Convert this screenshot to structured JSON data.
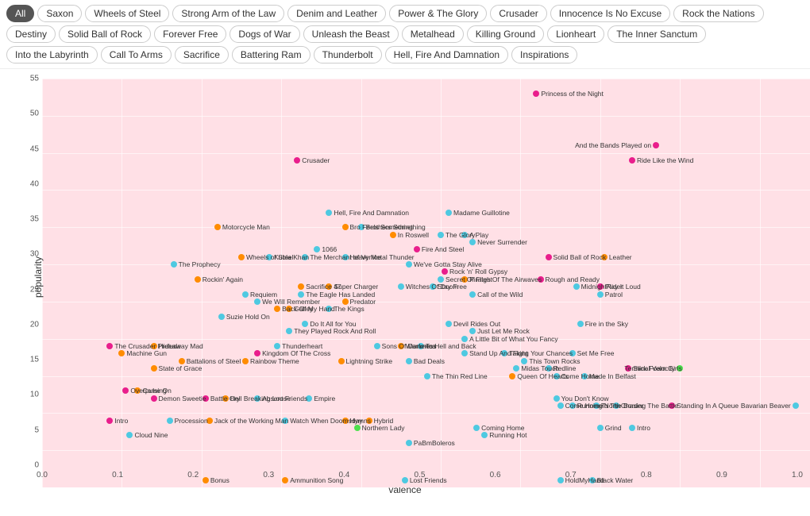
{
  "filters": {
    "rows": [
      [
        {
          "label": "All",
          "active": true
        },
        {
          "label": "Saxon",
          "active": false
        },
        {
          "label": "Wheels of Steel",
          "active": false
        },
        {
          "label": "Strong Arm of the Law",
          "active": false
        },
        {
          "label": "Denim and Leather",
          "active": false
        },
        {
          "label": "Power & The Glory",
          "active": false
        },
        {
          "label": "Crusader",
          "active": false
        },
        {
          "label": "Innocence Is No Excuse",
          "active": false
        },
        {
          "label": "Rock the Nations",
          "active": false
        }
      ],
      [
        {
          "label": "Destiny",
          "active": false
        },
        {
          "label": "Solid Ball of Rock",
          "active": false
        },
        {
          "label": "Forever Free",
          "active": false
        },
        {
          "label": "Dogs of War",
          "active": false
        },
        {
          "label": "Unleash the Beast",
          "active": false
        },
        {
          "label": "Metalhead",
          "active": false
        },
        {
          "label": "Killing Ground",
          "active": false
        },
        {
          "label": "Lionheart",
          "active": false
        },
        {
          "label": "The Inner Sanctum",
          "active": false
        }
      ],
      [
        {
          "label": "Into the Labyrinth",
          "active": false
        },
        {
          "label": "Call To Arms",
          "active": false
        },
        {
          "label": "Sacrifice",
          "active": false
        },
        {
          "label": "Battering Ram",
          "active": false
        },
        {
          "label": "Thunderbolt",
          "active": false
        },
        {
          "label": "Hell, Fire And Damnation",
          "active": false
        },
        {
          "label": "Inspirations",
          "active": false
        }
      ]
    ]
  },
  "chart": {
    "xlabel": "valence",
    "ylabel": "popularity",
    "xmin": 0,
    "xmax": 1,
    "ymin": 0,
    "ymax": 55,
    "xticks": [
      0,
      0.1,
      0.2,
      0.3,
      0.4,
      0.5,
      0.6,
      0.7,
      0.8,
      0.9,
      1.0
    ],
    "yticks": [
      0,
      5,
      10,
      15,
      20,
      25,
      30,
      35,
      40,
      45,
      50,
      55
    ],
    "points": [
      {
        "label": "Princess of the Night",
        "x": 0.62,
        "y": 53,
        "color": "#e91e8c",
        "labelside": "right"
      },
      {
        "label": "And the Bands Played on",
        "x": 0.77,
        "y": 46,
        "color": "#e91e8c",
        "labelside": "left"
      },
      {
        "label": "Ride Like the Wind",
        "x": 0.74,
        "y": 44,
        "color": "#e91e8c",
        "labelside": "right"
      },
      {
        "label": "Crusader",
        "x": 0.32,
        "y": 44,
        "color": "#e91e8c",
        "labelside": "right"
      },
      {
        "label": "Madame Guillotine",
        "x": 0.51,
        "y": 37,
        "color": "#4ec9e1",
        "labelside": "right"
      },
      {
        "label": "Hell, Fire And Damnation",
        "x": 0.36,
        "y": 37,
        "color": "#4ec9e1",
        "labelside": "right"
      },
      {
        "label": "Brothers Something",
        "x": 0.4,
        "y": 35,
        "color": "#4ec9e1",
        "labelside": "right"
      },
      {
        "label": "Bro Feels Something",
        "x": 0.38,
        "y": 35,
        "color": "#ff8c00",
        "labelside": "right"
      },
      {
        "label": "In Roswell",
        "x": 0.44,
        "y": 34,
        "color": "#ff8c00",
        "labelside": "right"
      },
      {
        "label": "The Glory",
        "x": 0.5,
        "y": 34,
        "color": "#4ec9e1",
        "labelside": "right"
      },
      {
        "label": "A Play",
        "x": 0.53,
        "y": 34,
        "color": "#4ec9e1",
        "labelside": "right"
      },
      {
        "label": "Never Surrender",
        "x": 0.54,
        "y": 33,
        "color": "#4ec9e1",
        "labelside": "right"
      },
      {
        "label": "Motorcycle Man",
        "x": 0.22,
        "y": 35,
        "color": "#ff8c00",
        "labelside": "right"
      },
      {
        "label": "Wheels of Steel",
        "x": 0.25,
        "y": 31,
        "color": "#ff8c00",
        "labelside": "right"
      },
      {
        "label": "The Prophecy",
        "x": 0.165,
        "y": 30,
        "color": "#4ec9e1",
        "labelside": "right"
      },
      {
        "label": "Fire And Steel",
        "x": 0.47,
        "y": 32,
        "color": "#e91e8c",
        "labelside": "right"
      },
      {
        "label": "Heavy Metal Thunder",
        "x": 0.38,
        "y": 31,
        "color": "#4ec9e1",
        "labelside": "right"
      },
      {
        "label": "1066",
        "x": 0.345,
        "y": 32,
        "color": "#4ec9e1",
        "labelside": "right"
      },
      {
        "label": "Kubla Khan",
        "x": 0.285,
        "y": 31,
        "color": "#4ec9e1",
        "labelside": "right"
      },
      {
        "label": "The Merchant of Venice",
        "x": 0.33,
        "y": 31,
        "color": "#4ec9e1",
        "labelside": "right"
      },
      {
        "label": "Solid Ball of Rock",
        "x": 0.635,
        "y": 31,
        "color": "#e91e8c",
        "labelside": "right"
      },
      {
        "label": "Leather",
        "x": 0.705,
        "y": 31,
        "color": "#ff8c00",
        "labelside": "right"
      },
      {
        "label": "Rock 'n' Roll Gypsy",
        "x": 0.505,
        "y": 29,
        "color": "#e91e8c",
        "labelside": "right"
      },
      {
        "label": "Pirates Of The Airwaves",
        "x": 0.53,
        "y": 28,
        "color": "#ff8c00",
        "labelside": "right"
      },
      {
        "label": "Rough and Ready",
        "x": 0.625,
        "y": 28,
        "color": "#e91e8c",
        "labelside": "right"
      },
      {
        "label": "Rockin' Again",
        "x": 0.195,
        "y": 28,
        "color": "#ff8c00",
        "labelside": "right"
      },
      {
        "label": "We've Gotta Stay Alive",
        "x": 0.46,
        "y": 30,
        "color": "#4ec9e1",
        "labelside": "right"
      },
      {
        "label": "Secret Of Flight",
        "x": 0.5,
        "y": 28,
        "color": "#4ec9e1",
        "labelside": "right"
      },
      {
        "label": "Witches Of Doom",
        "x": 0.45,
        "y": 27,
        "color": "#4ec9e1",
        "labelside": "right"
      },
      {
        "label": "Stay Free",
        "x": 0.49,
        "y": 27,
        "color": "#4ec9e1",
        "labelside": "right"
      },
      {
        "label": "Play It Loud",
        "x": 0.7,
        "y": 27,
        "color": "#e91e8c",
        "labelside": "right"
      },
      {
        "label": "MidnightRider",
        "x": 0.67,
        "y": 27,
        "color": "#4ec9e1",
        "labelside": "right"
      },
      {
        "label": "Patrol",
        "x": 0.7,
        "y": 26,
        "color": "#4ec9e1",
        "labelside": "right"
      },
      {
        "label": "Sacrifice 47",
        "x": 0.325,
        "y": 27,
        "color": "#ff8c00",
        "labelside": "right"
      },
      {
        "label": "Super Charger",
        "x": 0.36,
        "y": 27,
        "color": "#ff8c00",
        "labelside": "right"
      },
      {
        "label": "The Eagle Has Landed",
        "x": 0.325,
        "y": 26,
        "color": "#4ec9e1",
        "labelside": "right"
      },
      {
        "label": "Predator",
        "x": 0.38,
        "y": 25,
        "color": "#ff8c00",
        "labelside": "right"
      },
      {
        "label": "Requiem",
        "x": 0.255,
        "y": 26,
        "color": "#4ec9e1",
        "labelside": "right"
      },
      {
        "label": "We Will Remember",
        "x": 0.27,
        "y": 25,
        "color": "#4ec9e1",
        "labelside": "right"
      },
      {
        "label": "Back Of My Hand",
        "x": 0.295,
        "y": 24,
        "color": "#ff8c00",
        "labelside": "right"
      },
      {
        "label": "Galley",
        "x": 0.31,
        "y": 24,
        "color": "#ff8c00",
        "labelside": "right"
      },
      {
        "label": "The Kings",
        "x": 0.36,
        "y": 24,
        "color": "#4ec9e1",
        "labelside": "right"
      },
      {
        "label": "Call of the Wild",
        "x": 0.54,
        "y": 26,
        "color": "#4ec9e1",
        "labelside": "right"
      },
      {
        "label": "Suzie Hold On",
        "x": 0.225,
        "y": 23,
        "color": "#4ec9e1",
        "labelside": "right"
      },
      {
        "label": "Do It All for You",
        "x": 0.33,
        "y": 22,
        "color": "#4ec9e1",
        "labelside": "right"
      },
      {
        "label": "They Played Rock And Roll",
        "x": 0.31,
        "y": 21,
        "color": "#4ec9e1",
        "labelside": "right"
      },
      {
        "label": "Devil Rides Out",
        "x": 0.51,
        "y": 22,
        "color": "#4ec9e1",
        "labelside": "right"
      },
      {
        "label": "Just Let Me Rock",
        "x": 0.54,
        "y": 21,
        "color": "#4ec9e1",
        "labelside": "right"
      },
      {
        "label": "Fire in the Sky",
        "x": 0.675,
        "y": 22,
        "color": "#4ec9e1",
        "labelside": "right"
      },
      {
        "label": "The Crusader Prelude",
        "x": 0.085,
        "y": 19,
        "color": "#e91e8c",
        "labelside": "right"
      },
      {
        "label": "Hideaway Mad",
        "x": 0.14,
        "y": 19,
        "color": "#ff8c00",
        "labelside": "right"
      },
      {
        "label": "A Little Bit of What You Fancy",
        "x": 0.53,
        "y": 20,
        "color": "#4ec9e1",
        "labelside": "right"
      },
      {
        "label": "To Hell and Back",
        "x": 0.475,
        "y": 19,
        "color": "#4ec9e1",
        "labelside": "right"
      },
      {
        "label": "Thunderheart",
        "x": 0.295,
        "y": 19,
        "color": "#4ec9e1",
        "labelside": "right"
      },
      {
        "label": "Sons Of Darkness",
        "x": 0.42,
        "y": 19,
        "color": "#4ec9e1",
        "labelside": "right"
      },
      {
        "label": "Wamerica",
        "x": 0.45,
        "y": 19,
        "color": "#ff8c00",
        "labelside": "right"
      },
      {
        "label": "Machine Gun",
        "x": 0.1,
        "y": 18,
        "color": "#ff8c00",
        "labelside": "right"
      },
      {
        "label": "Kingdom Of The Cross",
        "x": 0.27,
        "y": 18,
        "color": "#e91e8c",
        "labelside": "right"
      },
      {
        "label": "Stand Up And Fight",
        "x": 0.53,
        "y": 18,
        "color": "#4ec9e1",
        "labelside": "right"
      },
      {
        "label": "Taking Your Chances",
        "x": 0.58,
        "y": 18,
        "color": "#4ec9e1",
        "labelside": "right"
      },
      {
        "label": "Set Me Free",
        "x": 0.665,
        "y": 18,
        "color": "#4ec9e1",
        "labelside": "right"
      },
      {
        "label": "Battalions of Steel",
        "x": 0.175,
        "y": 17,
        "color": "#ff8c00",
        "labelside": "right"
      },
      {
        "label": "Rainbow Theme",
        "x": 0.255,
        "y": 17,
        "color": "#ff8c00",
        "labelside": "right"
      },
      {
        "label": "Lightning Strike",
        "x": 0.375,
        "y": 17,
        "color": "#ff8c00",
        "labelside": "right"
      },
      {
        "label": "Bad Deals",
        "x": 0.46,
        "y": 17,
        "color": "#4ec9e1",
        "labelside": "right"
      },
      {
        "label": "This Town Rocks",
        "x": 0.605,
        "y": 17,
        "color": "#4ec9e1",
        "labelside": "right"
      },
      {
        "label": "Midas Touch",
        "x": 0.595,
        "y": 16,
        "color": "#4ec9e1",
        "labelside": "right"
      },
      {
        "label": "Redline",
        "x": 0.635,
        "y": 16,
        "color": "#4ec9e1",
        "labelside": "right"
      },
      {
        "label": "Terminal Velocity",
        "x": 0.8,
        "y": 16,
        "color": "#4de04d",
        "labelside": "left"
      },
      {
        "label": "Slick Foam Girls",
        "x": 0.735,
        "y": 16,
        "color": "#e91e8c",
        "labelside": "right"
      },
      {
        "label": "State of Grace",
        "x": 0.14,
        "y": 16,
        "color": "#ff8c00",
        "labelside": "right"
      },
      {
        "label": "Made In Belfast",
        "x": 0.68,
        "y": 15,
        "color": "#4ec9e1",
        "labelside": "right"
      },
      {
        "label": "Queen Of Hearts",
        "x": 0.59,
        "y": 15,
        "color": "#ff8c00",
        "labelside": "right"
      },
      {
        "label": "Come Home",
        "x": 0.645,
        "y": 15,
        "color": "#4ec9e1",
        "labelside": "right"
      },
      {
        "label": "The Thin Red Line",
        "x": 0.483,
        "y": 15,
        "color": "#4ec9e1",
        "labelside": "right"
      },
      {
        "label": "Come On",
        "x": 0.12,
        "y": 13,
        "color": "#ff8c00",
        "labelside": "right"
      },
      {
        "label": "Overpulsing",
        "x": 0.105,
        "y": 13,
        "color": "#e91e8c",
        "labelside": "right"
      },
      {
        "label": "Demon Sweetie",
        "x": 0.14,
        "y": 12,
        "color": "#e91e8c",
        "labelside": "right"
      },
      {
        "label": "Battle Cry",
        "x": 0.205,
        "y": 12,
        "color": "#e91e8c",
        "labelside": "right"
      },
      {
        "label": "Hell Breaking Loose",
        "x": 0.23,
        "y": 12,
        "color": "#ff8c00",
        "labelside": "right"
      },
      {
        "label": "Absent Friends",
        "x": 0.27,
        "y": 12,
        "color": "#4ec9e1",
        "labelside": "right"
      },
      {
        "label": "Empire",
        "x": 0.335,
        "y": 12,
        "color": "#4ec9e1",
        "labelside": "right"
      },
      {
        "label": "You Don't Know",
        "x": 0.645,
        "y": 12,
        "color": "#4ec9e1",
        "labelside": "right"
      },
      {
        "label": "Come Home",
        "x": 0.65,
        "y": 11,
        "color": "#4ec9e1",
        "labelside": "right"
      },
      {
        "label": "Running North",
        "x": 0.665,
        "y": 11,
        "color": "#4ec9e1",
        "labelside": "right"
      },
      {
        "label": "To The Border",
        "x": 0.695,
        "y": 11,
        "color": "#4ec9e1",
        "labelside": "right"
      },
      {
        "label": "Chasing The Battle",
        "x": 0.72,
        "y": 11,
        "color": "#4ec9e1",
        "labelside": "right"
      },
      {
        "label": "Standing In A Queue",
        "x": 0.79,
        "y": 11,
        "color": "#e91e8c",
        "labelside": "right"
      },
      {
        "label": "Bavarian Beaver",
        "x": 0.945,
        "y": 11,
        "color": "#4ec9e1",
        "labelside": "left"
      },
      {
        "label": "Intro",
        "x": 0.085,
        "y": 9,
        "color": "#e91e8c",
        "labelside": "right"
      },
      {
        "label": "Procession",
        "x": 0.16,
        "y": 9,
        "color": "#4ec9e1",
        "labelside": "right"
      },
      {
        "label": "Jack of the Working Man",
        "x": 0.21,
        "y": 9,
        "color": "#ff8c00",
        "labelside": "right"
      },
      {
        "label": "Watch When Doomsday",
        "x": 0.305,
        "y": 9,
        "color": "#4ec9e1",
        "labelside": "right"
      },
      {
        "label": "Hymns",
        "x": 0.38,
        "y": 9,
        "color": "#ff8c00",
        "labelside": "right"
      },
      {
        "label": "Hybrid",
        "x": 0.41,
        "y": 9,
        "color": "#ff8c00",
        "labelside": "right"
      },
      {
        "label": "Northern Lady",
        "x": 0.395,
        "y": 8,
        "color": "#4de04d",
        "labelside": "right"
      },
      {
        "label": "Cloud Nine",
        "x": 0.11,
        "y": 7,
        "color": "#4ec9e1",
        "labelside": "right"
      },
      {
        "label": "Coming Home",
        "x": 0.545,
        "y": 8,
        "color": "#4ec9e1",
        "labelside": "right"
      },
      {
        "label": "Grind",
        "x": 0.7,
        "y": 8,
        "color": "#4ec9e1",
        "labelside": "right"
      },
      {
        "label": "Intro",
        "x": 0.74,
        "y": 8,
        "color": "#4ec9e1",
        "labelside": "right"
      },
      {
        "label": "Running Hot",
        "x": 0.555,
        "y": 7,
        "color": "#4ec9e1",
        "labelside": "right"
      },
      {
        "label": "PaBmBoleros",
        "x": 0.46,
        "y": 6,
        "color": "#4ec9e1",
        "labelside": "right"
      },
      {
        "label": "Bonus",
        "x": 0.205,
        "y": 1,
        "color": "#ff8c00",
        "labelside": "right"
      },
      {
        "label": "Ammunition Song",
        "x": 0.305,
        "y": 1,
        "color": "#ff8c00",
        "labelside": "right"
      },
      {
        "label": "Lost Friends",
        "x": 0.455,
        "y": 1,
        "color": "#4ec9e1",
        "labelside": "right"
      },
      {
        "label": "HoldMyHand",
        "x": 0.65,
        "y": 1,
        "color": "#4ec9e1",
        "labelside": "right"
      },
      {
        "label": "Black Water",
        "x": 0.69,
        "y": 1,
        "color": "#4ec9e1",
        "labelside": "right"
      }
    ]
  }
}
